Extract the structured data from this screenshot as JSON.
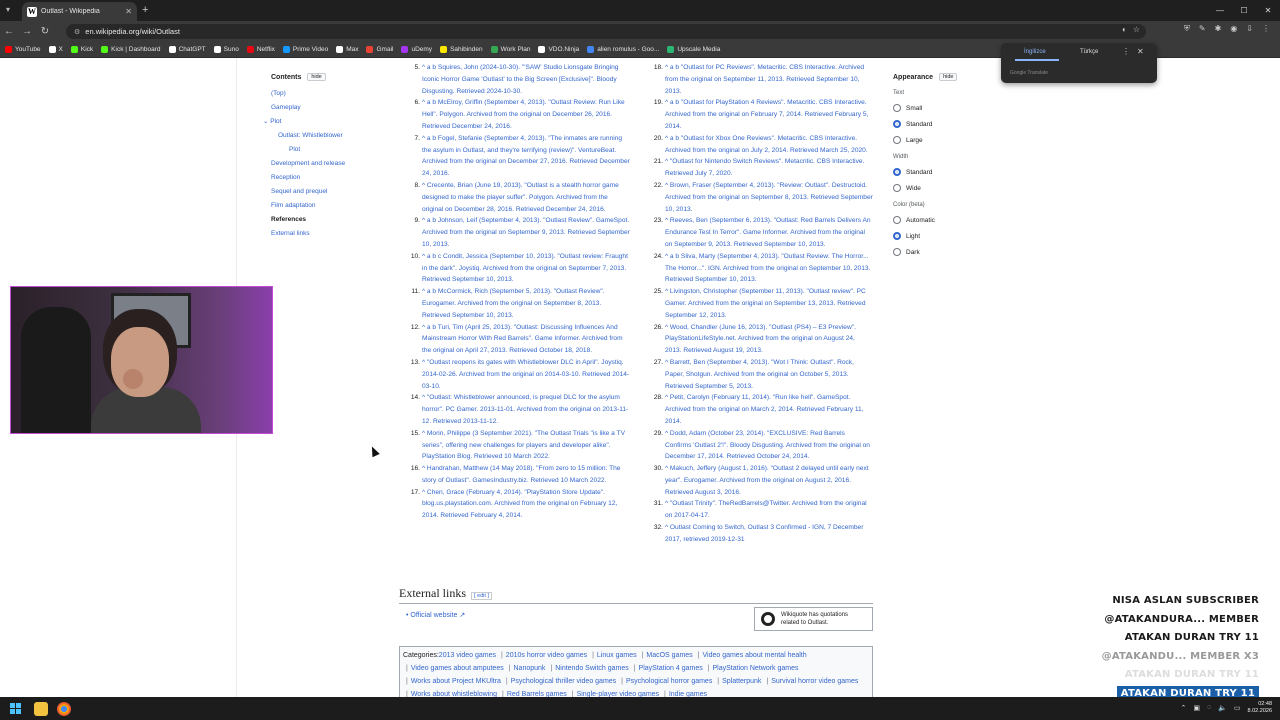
{
  "browser": {
    "tab_title": "Outlast - Wikipedia",
    "tab_favicon": "W",
    "url": "en.wikipedia.org/wiki/Outlast",
    "bookmarks": [
      {
        "label": "YouTube",
        "color": "#ff0000"
      },
      {
        "label": "X",
        "color": "#ffffff"
      },
      {
        "label": "Kick",
        "color": "#53fc18"
      },
      {
        "label": "Kick | Dashboard",
        "color": "#53fc18"
      },
      {
        "label": "ChatGPT",
        "color": "#ffffff"
      },
      {
        "label": "Suno",
        "color": "#ffffff"
      },
      {
        "label": "Netflix",
        "color": "#e50914"
      },
      {
        "label": "Prime Video",
        "color": "#1399ff"
      },
      {
        "label": "Max",
        "color": "#ffffff"
      },
      {
        "label": "Gmail",
        "color": "#ea4335"
      },
      {
        "label": "uDemy",
        "color": "#a435f0"
      },
      {
        "label": "Sahibinden",
        "color": "#ffe800"
      },
      {
        "label": "Work Plan",
        "color": "#34a853"
      },
      {
        "label": "VDO.Ninja",
        "color": "#ffffff"
      },
      {
        "label": "alien romulus - Goo...",
        "color": "#4285f4"
      },
      {
        "label": "Upscale Media",
        "color": "#2bb673"
      }
    ]
  },
  "toc": {
    "title": "Contents",
    "hide_label": "hide",
    "items": [
      {
        "label": "(Top)",
        "level": 0
      },
      {
        "label": "Gameplay",
        "level": 0
      },
      {
        "label": "Plot",
        "level": 0,
        "expanded": true
      },
      {
        "label": "Outlast: Whistleblower",
        "level": 1
      },
      {
        "label": "Plot",
        "level": 2
      },
      {
        "label": "Development and release",
        "level": 0
      },
      {
        "label": "Reception",
        "level": 0
      },
      {
        "label": "Sequel and prequel",
        "level": 0
      },
      {
        "label": "Film adaptation",
        "level": 0
      },
      {
        "label": "References",
        "level": 0,
        "current": true
      },
      {
        "label": "External links",
        "level": 0
      }
    ]
  },
  "appearance": {
    "title": "Appearance",
    "hide_label": "hide",
    "groups": [
      {
        "label": "Text",
        "options": [
          "Small",
          "Standard",
          "Large"
        ],
        "selected": "Standard"
      },
      {
        "label": "Width",
        "options": [
          "Standard",
          "Wide"
        ],
        "selected": "Standard"
      },
      {
        "label": "Color (beta)",
        "options": [
          "Automatic",
          "Light",
          "Dark"
        ],
        "selected": "Light"
      }
    ]
  },
  "references": {
    "left": [
      {
        "n": "5.",
        "text": "^ a b Squires, John (2024-10-30). \"'SAW' Studio Lionsgate Bringing Iconic Horror Game 'Outlast' to the Big Screen [Exclusive]\". Bloody Disgusting. Retrieved 2024-10-30."
      },
      {
        "n": "6.",
        "text": "^ a b McElroy, Griffin (September 4, 2013). \"Outlast Review: Run Like Hell\". Polygon. Archived from the original on December 26, 2016. Retrieved December 24, 2016."
      },
      {
        "n": "7.",
        "text": "^ a b Fogel, Stefanie (September 4, 2013). \"The inmates are running the asylum in Outlast, and they're terrifying (review)\". VentureBeat. Archived from the original on December 27, 2016. Retrieved December 24, 2016."
      },
      {
        "n": "8.",
        "text": "^ Crecente, Brian (June 19, 2013). \"Outlast is a stealth horror game designed to make the player suffer\". Polygon. Archived from the original on December 28, 2016. Retrieved December 24, 2016."
      },
      {
        "n": "9.",
        "text": "^ a b Johnson, Leif (September 4, 2013). \"Outlast Review\". GameSpot. Archived from the original on September 9, 2013. Retrieved September 10, 2013."
      },
      {
        "n": "10.",
        "text": "^ a b c Condit, Jessica (September 10, 2013). \"Outlast review: Fraught in the dark\". Joystiq. Archived from the original on September 7, 2013. Retrieved September 10, 2013."
      },
      {
        "n": "11.",
        "text": "^ a b McCormick, Rich (September 5, 2013). \"Outlast Review\". Eurogamer. Archived from the original on September 8, 2013. Retrieved September 10, 2013."
      },
      {
        "n": "12.",
        "text": "^ a b Turi, Tim (April 25, 2013). \"Outlast: Discussing Influences And Mainstream Horror With Red Barrels\". Game Informer. Archived from the original on April 27, 2013. Retrieved October 18, 2018."
      },
      {
        "n": "13.",
        "text": "^ \"Outlast reopens its gates with Whistleblower DLC in April\". Joystiq. 2014-02-26. Archived from the original on 2014-03-10. Retrieved 2014-03-10."
      },
      {
        "n": "14.",
        "text": "^ \"Outlast: Whistleblower announced, is prequel DLC for the asylum horror\". PC Gamer. 2013-11-01. Archived from the original on 2013-11-12. Retrieved 2013-11-12."
      },
      {
        "n": "15.",
        "text": "^ Morin, Philippe (3 September 2021). \"The Outlast Trials \"is like a TV series\", offering new challenges for players and developer alike\". PlayStation Blog. Retrieved 10 March 2022."
      },
      {
        "n": "16.",
        "text": "^ Handrahan, Matthew (14 May 2018). \"From zero to 15 million: The story of Outlast\". GamesIndustry.biz. Retrieved 10 March 2022."
      },
      {
        "n": "17.",
        "text": "^ Chen, Grace (February 4, 2014). \"PlayStation Store Update\". blog.us.playstation.com. Archived from the original on February 12, 2014. Retrieved February 4, 2014."
      }
    ],
    "right": [
      {
        "n": "18.",
        "text": "^ a b \"Outlast for PC Reviews\". Metacritic. CBS Interactive. Archived from the original on September 11, 2013. Retrieved September 10, 2013."
      },
      {
        "n": "19.",
        "text": "^ a b \"Outlast for PlayStation 4 Reviews\". Metacritic. CBS Interactive. Archived from the original on February 7, 2014. Retrieved February 5, 2014."
      },
      {
        "n": "20.",
        "text": "^ a b \"Outlast for Xbox One Reviews\". Metacritic. CBS Interactive. Archived from the original on July 2, 2014. Retrieved March 25, 2020."
      },
      {
        "n": "21.",
        "text": "^ \"Outlast for Nintendo Switch Reviews\". Metacritic. CBS Interactive. Retrieved July 7, 2020."
      },
      {
        "n": "22.",
        "text": "^ Brown, Fraser (September 4, 2013). \"Review: Outlast\". Destructoid. Archived from the original on September 8, 2013. Retrieved September 10, 2013."
      },
      {
        "n": "23.",
        "text": "^ Reeves, Ben (September 6, 2013). \"Outlast: Red Barrels Delivers An Endurance Test In Terror\". Game Informer. Archived from the original on September 9, 2013. Retrieved September 10, 2013."
      },
      {
        "n": "24.",
        "text": "^ a b Sliva, Marty (September 4, 2013). \"Outlast Review: The Horror... The Horror...\". IGN. Archived from the original on September 10, 2013. Retrieved September 10, 2013."
      },
      {
        "n": "25.",
        "text": "^ Livingston, Christopher (September 11, 2013). \"Outlast review\". PC Gamer. Archived from the original on September 13, 2013. Retrieved September 12, 2013."
      },
      {
        "n": "26.",
        "text": "^ Wood, Chandler (June 16, 2013). \"Outlast (PS4) – E3 Preview\". PlayStationLifeStyle.net. Archived from the original on August 24, 2013. Retrieved August 19, 2013."
      },
      {
        "n": "27.",
        "text": "^ Barrett, Ben (September 4, 2013). \"Wot I Think: Outlast\". Rock, Paper, Shotgun. Archived from the original on October 5, 2013. Retrieved September 5, 2013."
      },
      {
        "n": "28.",
        "text": "^ Petit, Carolyn (February 11, 2014). \"Run like hell\". GameSpot. Archived from the original on March 2, 2014. Retrieved February 11, 2014."
      },
      {
        "n": "29.",
        "text": "^ Dodd, Adam (October 23, 2014). \"EXCLUSIVE: Red Barrels Confirms 'Outlast 2'!\". Bloody Disgusting. Archived from the original on December 17, 2014. Retrieved October 24, 2014."
      },
      {
        "n": "30.",
        "text": "^ Makuch, Jeffery (August 1, 2016). \"Outlast 2 delayed until early next year\". Eurogamer. Archived from the original on August 2, 2016. Retrieved August 3, 2016."
      },
      {
        "n": "31.",
        "text": "^ \"Outlast Trinity\". TheRedBarrels@Twitter. Archived from the original on 2017-04-17."
      },
      {
        "n": "32.",
        "text": "^ Outlast Coming to Switch, Outlast 3 Confirmed - IGN, 7 December 2017, retrieved 2019-12-31"
      }
    ]
  },
  "external_links": {
    "heading": "External links",
    "edit_label": "edit",
    "official": "Official website",
    "wikiquote_line1": "Wikiquote has quotations",
    "wikiquote_line2": "related to Outlast."
  },
  "categories": {
    "label": "Categories:",
    "items": [
      "2013 video games",
      "2010s horror video games",
      "Linux games",
      "MacOS games",
      "Video games about mental health",
      "Video games about amputees",
      "Nanopunk",
      "Nintendo Switch games",
      "PlayStation 4 games",
      "PlayStation Network games",
      "Works about Project MKUltra",
      "Psychological thriller video games",
      "Psychological horror games",
      "Splatterpunk",
      "Survival horror video games",
      "Works about whistleblowing",
      "Red Barrels games",
      "Single-player video games",
      "Indie games"
    ]
  },
  "translate_popup": {
    "lang_active": "İngilizce",
    "lang_other": "Türkçe",
    "footer": "Google Translate"
  },
  "stream_overlay": [
    {
      "text": "NISA ASLAN   SUBSCRIBER",
      "style": "normal"
    },
    {
      "text": "@ATAKANDURA...   MEMBER",
      "style": "normal"
    },
    {
      "text": "ATAKAN DURAN   TRY 11",
      "style": "normal"
    },
    {
      "text": "@ATAKANDU...   MEMBER X3",
      "style": "fade1"
    },
    {
      "text": "ATAKAN DURAN   TRY 11",
      "style": "fade2"
    },
    {
      "text": "ATAKAN DURAN   TRY 11",
      "style": "highlight"
    }
  ],
  "taskbar": {
    "clock_time": "02:48",
    "clock_date": "8.02.2026",
    "start_color": "#4cc2ff"
  }
}
